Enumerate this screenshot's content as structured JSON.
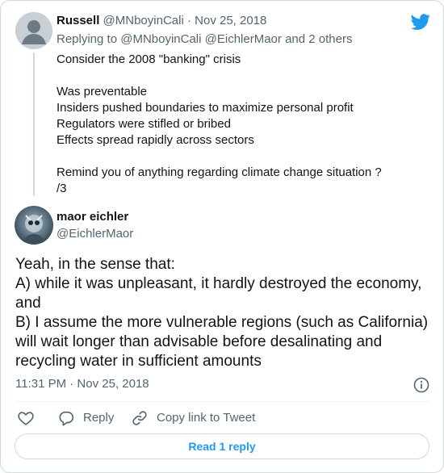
{
  "parent_tweet": {
    "author_name": "Russell",
    "author_handle": "@MNboyinCali",
    "separator": "·",
    "date": "Nov 25, 2018",
    "replying_prefix": "Replying to",
    "replying_handles": "@MNboyinCali @EichlerMaor",
    "replying_suffix": "and 2 others",
    "body_lines": [
      "Consider the 2008 \"banking\" crisis",
      "",
      "Was preventable",
      "Insiders pushed boundaries to maximize personal profit",
      "Regulators were stifled or bribed",
      "Effects spread rapidly across sectors",
      "",
      "Remind you of anything regarding climate change situation ?",
      "/3"
    ]
  },
  "main_tweet": {
    "author_name": "maor eichler",
    "author_handle": "@EichlerMaor",
    "body_lines": [
      "Yeah, in the sense that:",
      "A) while it was unpleasant, it hardly destroyed the economy, and",
      "B) I assume the more vulnerable regions (such as California) will wait longer than advisable before desalinating and recycling water in sufficient amounts"
    ],
    "timestamp": "11:31 PM · Nov 25, 2018"
  },
  "actions": {
    "reply_label": "Reply",
    "copy_label": "Copy link to Tweet",
    "read_replies_label": "Read 1 reply"
  },
  "colors": {
    "accent": "#1d9bf0",
    "muted_text": "#536471",
    "border": "#cfd9de"
  },
  "icons": [
    "twitter-bird-icon",
    "heart-icon",
    "reply-bubble-icon",
    "link-icon",
    "info-icon"
  ]
}
